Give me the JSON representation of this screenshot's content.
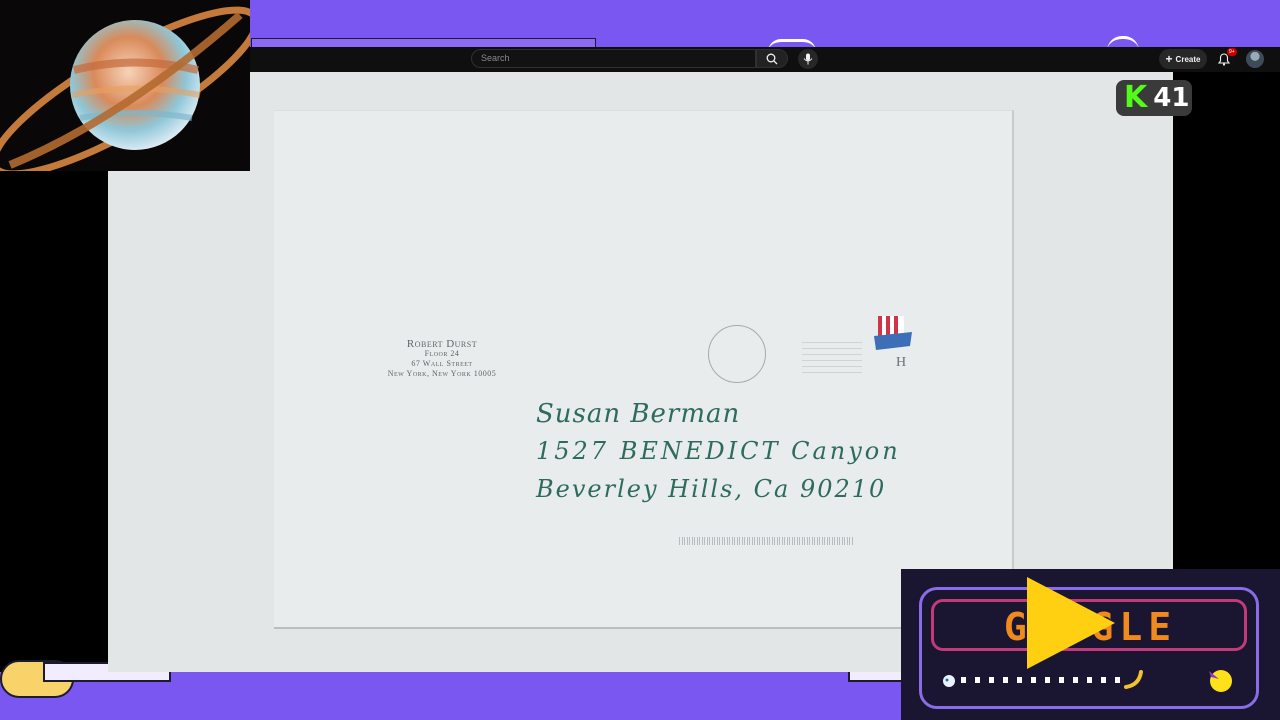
{
  "header": {
    "search_placeholder": "Search",
    "create_label": "Create",
    "notification_badge": "9+"
  },
  "kick_badge": {
    "logo_letter": "K",
    "count": "41"
  },
  "envelope": {
    "return_address": {
      "name": "Robert Durst",
      "floor": "Floor 24",
      "street": "67 Wall Street",
      "city": "New York, New York 10005"
    },
    "recipient": {
      "line1": "Susan Berman",
      "line2": "1527 BENEDICT Canyon",
      "line3": "Beverley Hills, Ca 90210"
    }
  },
  "doodle": {
    "text": "GO GLE"
  },
  "colors": {
    "background_purple": "#7b57f2",
    "header_dark": "#0f0f0f",
    "kick_green": "#53fc18",
    "ink_green": "#2e6b5f",
    "doodle_orange": "#f08a1c",
    "doodle_yellow": "#ffd012"
  }
}
